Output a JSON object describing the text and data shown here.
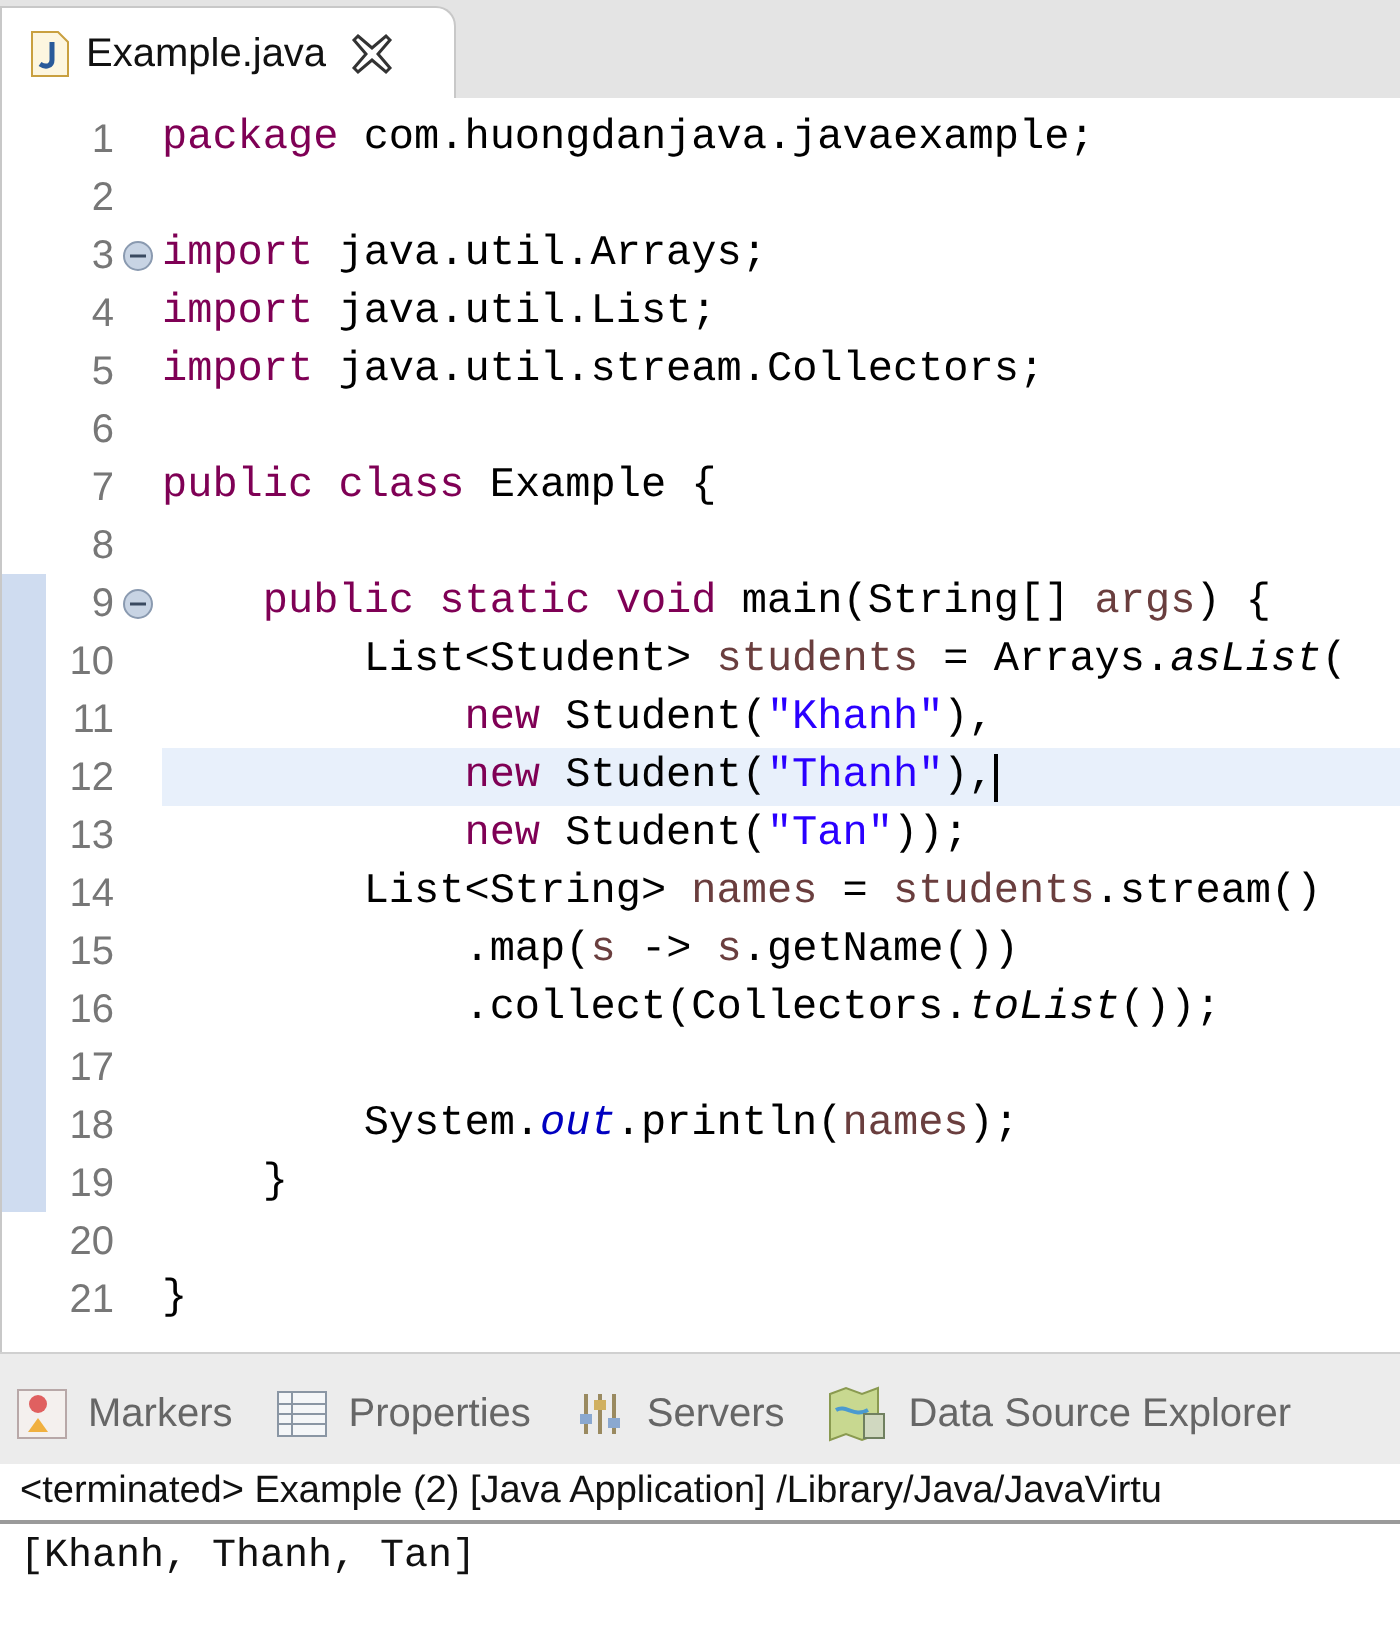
{
  "editor_tab": {
    "title": "Example.java",
    "selected": true
  },
  "code_lines": [
    {
      "number": "1",
      "fold": false,
      "marked": false,
      "highlighted": false,
      "caret": false,
      "tokens": [
        {
          "kind": "keyword",
          "text": "package"
        },
        {
          "kind": "plain",
          "text": " com.huongdanjava.javaexample;"
        }
      ]
    },
    {
      "number": "2",
      "fold": false,
      "marked": false,
      "highlighted": false,
      "caret": false
    },
    {
      "number": "3",
      "fold": true,
      "marked": false,
      "highlighted": false,
      "caret": false,
      "tokens": [
        {
          "kind": "keyword",
          "text": "import"
        },
        {
          "kind": "plain",
          "text": " java.util.Arrays;"
        }
      ]
    },
    {
      "number": "4",
      "fold": false,
      "marked": false,
      "highlighted": false,
      "caret": false,
      "tokens": [
        {
          "kind": "keyword",
          "text": "import"
        },
        {
          "kind": "plain",
          "text": " java.util.List;"
        }
      ]
    },
    {
      "number": "5",
      "fold": false,
      "marked": false,
      "highlighted": false,
      "caret": false,
      "tokens": [
        {
          "kind": "keyword",
          "text": "import"
        },
        {
          "kind": "plain",
          "text": " java.util.stream.Collectors;"
        }
      ]
    },
    {
      "number": "6",
      "fold": false,
      "marked": false,
      "highlighted": false,
      "caret": false
    },
    {
      "number": "7",
      "fold": false,
      "marked": false,
      "highlighted": false,
      "caret": false,
      "tokens": [
        {
          "kind": "keyword",
          "text": "public class"
        },
        {
          "kind": "plain",
          "text": " Example {"
        }
      ]
    },
    {
      "number": "8",
      "fold": false,
      "marked": false,
      "highlighted": false,
      "caret": false
    },
    {
      "number": "9",
      "fold": true,
      "marked": true,
      "highlighted": false,
      "caret": false,
      "tokens": [
        {
          "kind": "keyword",
          "text": "    public static void"
        },
        {
          "kind": "plain",
          "text": " main(String[] "
        },
        {
          "kind": "local",
          "text": "args"
        },
        {
          "kind": "plain",
          "text": ") {"
        }
      ]
    },
    {
      "number": "10",
      "fold": false,
      "marked": true,
      "highlighted": false,
      "caret": false,
      "tokens": [
        {
          "kind": "plain",
          "text": "        List<Student> "
        },
        {
          "kind": "local",
          "text": "students"
        },
        {
          "kind": "plain",
          "text": " = Arrays."
        },
        {
          "kind": "static",
          "text": "asList"
        },
        {
          "kind": "plain",
          "text": "("
        }
      ]
    },
    {
      "number": "11",
      "fold": false,
      "marked": true,
      "highlighted": false,
      "caret": false,
      "tokens": [
        {
          "kind": "keyword",
          "text": "            new"
        },
        {
          "kind": "plain",
          "text": " Student("
        },
        {
          "kind": "string",
          "text": "\"Khanh\""
        },
        {
          "kind": "plain",
          "text": "),"
        }
      ]
    },
    {
      "number": "12",
      "fold": false,
      "marked": true,
      "highlighted": true,
      "caret": true,
      "tokens": [
        {
          "kind": "keyword",
          "text": "            new"
        },
        {
          "kind": "plain",
          "text": " Student("
        },
        {
          "kind": "string",
          "text": "\"Thanh\""
        },
        {
          "kind": "plain",
          "text": "),"
        }
      ]
    },
    {
      "number": "13",
      "fold": false,
      "marked": true,
      "highlighted": false,
      "caret": false,
      "tokens": [
        {
          "kind": "keyword",
          "text": "            new"
        },
        {
          "kind": "plain",
          "text": " Student("
        },
        {
          "kind": "string",
          "text": "\"Tan\""
        },
        {
          "kind": "plain",
          "text": "));"
        }
      ]
    },
    {
      "number": "14",
      "fold": false,
      "marked": true,
      "highlighted": false,
      "caret": false,
      "tokens": [
        {
          "kind": "plain",
          "text": "        List<String> "
        },
        {
          "kind": "local",
          "text": "names"
        },
        {
          "kind": "plain",
          "text": " = "
        },
        {
          "kind": "local",
          "text": "students"
        },
        {
          "kind": "plain",
          "text": ".stream()"
        }
      ]
    },
    {
      "number": "15",
      "fold": false,
      "marked": true,
      "highlighted": false,
      "caret": false,
      "tokens": [
        {
          "kind": "plain",
          "text": "            .map("
        },
        {
          "kind": "local",
          "text": "s"
        },
        {
          "kind": "plain",
          "text": " -> "
        },
        {
          "kind": "local",
          "text": "s"
        },
        {
          "kind": "plain",
          "text": ".getName())"
        }
      ]
    },
    {
      "number": "16",
      "fold": false,
      "marked": true,
      "highlighted": false,
      "caret": false,
      "tokens": [
        {
          "kind": "plain",
          "text": "            .collect(Collectors."
        },
        {
          "kind": "static",
          "text": "toList"
        },
        {
          "kind": "plain",
          "text": "());"
        }
      ]
    },
    {
      "number": "17",
      "fold": false,
      "marked": true,
      "highlighted": false,
      "caret": false
    },
    {
      "number": "18",
      "fold": false,
      "marked": true,
      "highlighted": false,
      "caret": false,
      "tokens": [
        {
          "kind": "plain",
          "text": "        System."
        },
        {
          "kind": "field",
          "text": "out"
        },
        {
          "kind": "plain",
          "text": ".println("
        },
        {
          "kind": "local",
          "text": "names"
        },
        {
          "kind": "plain",
          "text": ");"
        }
      ]
    },
    {
      "number": "19",
      "fold": false,
      "marked": true,
      "highlighted": false,
      "caret": false,
      "tokens": [
        {
          "kind": "plain",
          "text": "    }"
        }
      ]
    },
    {
      "number": "20",
      "fold": false,
      "marked": false,
      "highlighted": false,
      "caret": false
    },
    {
      "number": "21",
      "fold": false,
      "marked": false,
      "highlighted": false,
      "caret": false,
      "tokens": [
        {
          "kind": "plain",
          "text": "}"
        }
      ]
    }
  ],
  "panel_tabs": [
    {
      "kind": "markers",
      "label": "Markers"
    },
    {
      "kind": "properties",
      "label": "Properties"
    },
    {
      "kind": "servers",
      "label": "Servers"
    },
    {
      "kind": "datasource",
      "label": "Data Source Explorer"
    }
  ],
  "console": {
    "header": "<terminated> Example (2) [Java Application] /Library/Java/JavaVirtu",
    "output": "[Khanh, Thanh, Tan]"
  }
}
